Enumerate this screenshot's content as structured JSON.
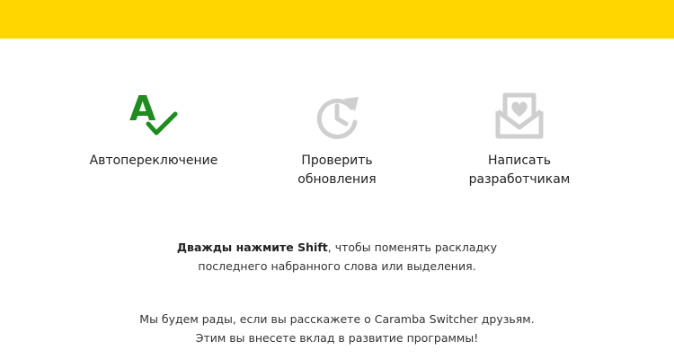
{
  "colors": {
    "top_bar": "#FFD600",
    "accent_green": "#1E8C1E",
    "icon_gray": "#CFCFCF"
  },
  "actions": [
    {
      "icon": "spell-check-icon",
      "label": "Автопереключение"
    },
    {
      "icon": "clock-refresh-icon",
      "label_line1": "Проверить",
      "label_line2": "обновления"
    },
    {
      "icon": "mail-heart-icon",
      "label_line1": "Написать",
      "label_line2": "разработчикам"
    }
  ],
  "hint": {
    "bold": "Дважды нажмите Shift",
    "rest_line1": ", чтобы поменять раскладку",
    "line2": "последнего набранного слова или выделения."
  },
  "share": {
    "line1": "Мы будем рады, если вы расскажете о Caramba Switcher друзьям.",
    "line2": "Этим вы внесете вклад в развитие программы!"
  }
}
